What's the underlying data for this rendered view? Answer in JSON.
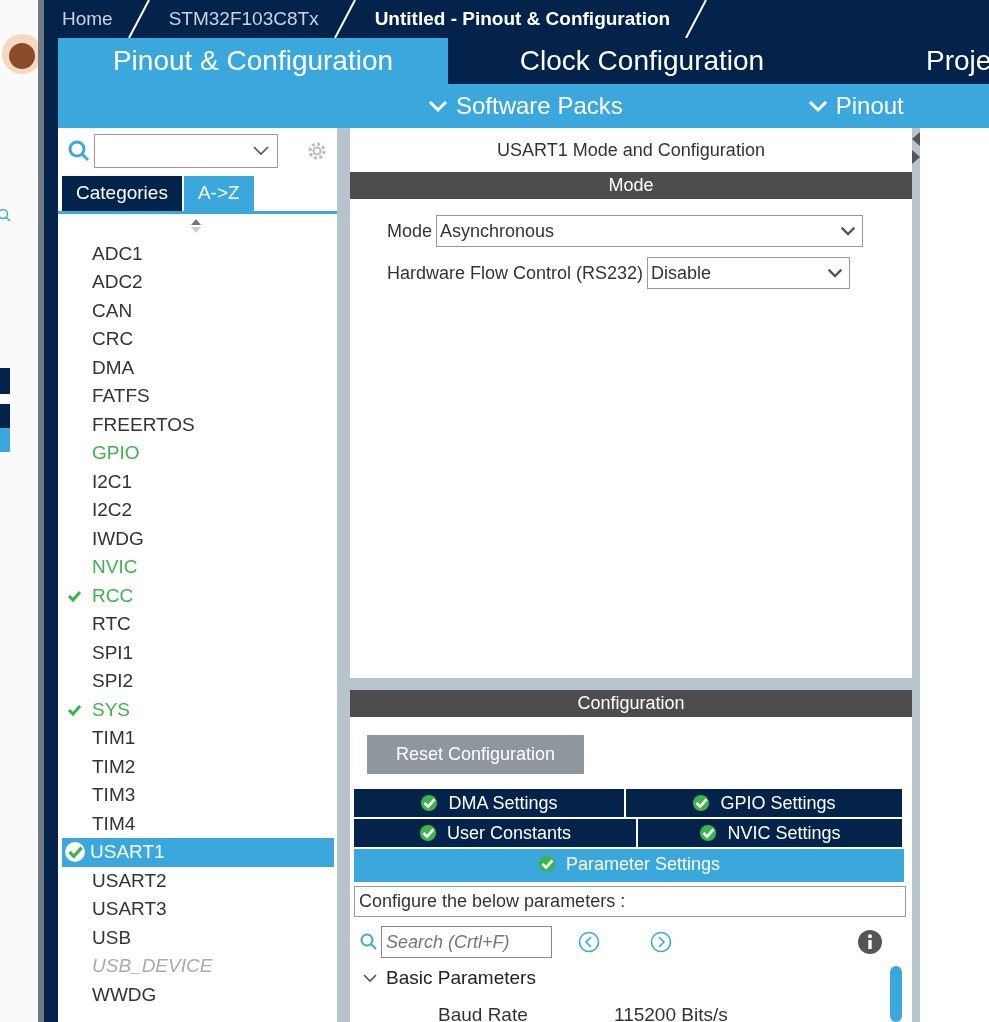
{
  "breadcrumb": [
    {
      "label": "Home",
      "selected": false
    },
    {
      "label": "STM32F103C8Tx",
      "selected": false
    },
    {
      "label": "Untitled - Pinout & Configuration",
      "selected": true
    }
  ],
  "main_tabs": [
    {
      "label": "Pinout & Configuration",
      "selected": true
    },
    {
      "label": "Clock Configuration",
      "selected": false
    },
    {
      "label": "Proje",
      "selected": false
    }
  ],
  "sub_menu": [
    "Software Packs",
    "Pinout"
  ],
  "sidebar": {
    "view_tabs": [
      {
        "label": "Categories",
        "selected": false
      },
      {
        "label": "A->Z",
        "selected": true
      }
    ],
    "items": [
      {
        "label": "ADC1",
        "kind": "plain",
        "selected": false
      },
      {
        "label": "ADC2",
        "kind": "plain",
        "selected": false
      },
      {
        "label": "CAN",
        "kind": "plain",
        "selected": false
      },
      {
        "label": "CRC",
        "kind": "plain",
        "selected": false
      },
      {
        "label": "DMA",
        "kind": "plain",
        "selected": false
      },
      {
        "label": "FATFS",
        "kind": "plain",
        "selected": false
      },
      {
        "label": "FREERTOS",
        "kind": "plain",
        "selected": false
      },
      {
        "label": "GPIO",
        "kind": "partial",
        "selected": false
      },
      {
        "label": "I2C1",
        "kind": "plain",
        "selected": false
      },
      {
        "label": "I2C2",
        "kind": "plain",
        "selected": false
      },
      {
        "label": "IWDG",
        "kind": "plain",
        "selected": false
      },
      {
        "label": "NVIC",
        "kind": "partial",
        "selected": false
      },
      {
        "label": "RCC",
        "kind": "ok",
        "selected": false
      },
      {
        "label": "RTC",
        "kind": "plain",
        "selected": false
      },
      {
        "label": "SPI1",
        "kind": "plain",
        "selected": false
      },
      {
        "label": "SPI2",
        "kind": "plain",
        "selected": false
      },
      {
        "label": "SYS",
        "kind": "ok",
        "selected": false
      },
      {
        "label": "TIM1",
        "kind": "plain",
        "selected": false
      },
      {
        "label": "TIM2",
        "kind": "plain",
        "selected": false
      },
      {
        "label": "TIM3",
        "kind": "plain",
        "selected": false
      },
      {
        "label": "TIM4",
        "kind": "plain",
        "selected": false
      },
      {
        "label": "USART1",
        "kind": "ok",
        "selected": true
      },
      {
        "label": "USART2",
        "kind": "plain",
        "selected": false
      },
      {
        "label": "USART3",
        "kind": "plain",
        "selected": false
      },
      {
        "label": "USB",
        "kind": "plain",
        "selected": false
      },
      {
        "label": "USB_DEVICE",
        "kind": "disabled",
        "selected": false
      },
      {
        "label": "WWDG",
        "kind": "plain",
        "selected": false
      }
    ]
  },
  "mode_panel": {
    "title": "USART1 Mode and Configuration",
    "section": "Mode",
    "fields": [
      {
        "label": "Mode",
        "value": "Asynchronous"
      },
      {
        "label": "Hardware Flow Control (RS232)",
        "value": "Disable"
      }
    ]
  },
  "configuration": {
    "section": "Configuration",
    "reset_button": "Reset Configuration",
    "tab_rows": [
      [
        {
          "label": "DMA Settings",
          "selected": false
        },
        {
          "label": "GPIO Settings",
          "selected": false
        }
      ],
      [
        {
          "label": "User Constants",
          "selected": false
        },
        {
          "label": "NVIC Settings",
          "selected": false
        }
      ],
      [
        {
          "label": "Parameter Settings",
          "selected": true
        }
      ]
    ],
    "description": "Configure the below parameters :",
    "search": {
      "placeholder": "Search (Crtl+F)"
    },
    "groups": [
      {
        "label": "Basic Parameters",
        "expanded": true,
        "params": [
          {
            "name": "Baud Rate",
            "value": "115200 Bits/s"
          }
        ]
      }
    ]
  }
}
